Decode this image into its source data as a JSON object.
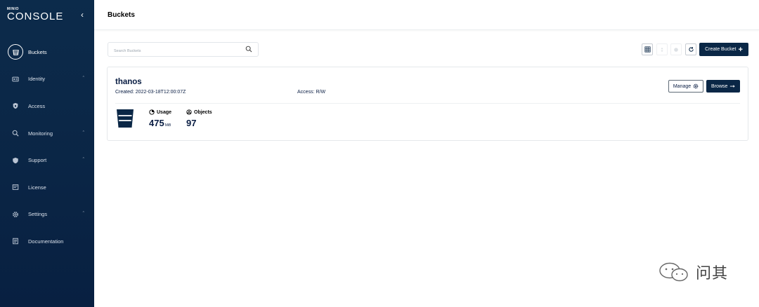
{
  "sidebar": {
    "logo_small": "MINIO",
    "logo_big": "CONSOLE",
    "items": [
      {
        "label": "Buckets",
        "icon": "bucket-icon",
        "active": true
      },
      {
        "label": "Identity",
        "icon": "identity-icon",
        "expandable": true
      },
      {
        "label": "Access",
        "icon": "lock-icon"
      },
      {
        "label": "Monitoring",
        "icon": "search-chart-icon",
        "expandable": true
      },
      {
        "label": "Support",
        "icon": "shield-icon",
        "expandable": true
      },
      {
        "label": "License",
        "icon": "license-icon"
      },
      {
        "label": "Settings",
        "icon": "gear-icon",
        "expandable": true
      },
      {
        "label": "Documentation",
        "icon": "document-icon"
      }
    ]
  },
  "header": {
    "title": "Buckets"
  },
  "search": {
    "placeholder": "Search Buckets"
  },
  "toolbar": {
    "create_label": "Create Bucket"
  },
  "bucket": {
    "name": "thanos",
    "created": "Created: 2022-03-18T12:00:07Z",
    "access": "Access: R/W",
    "manage_label": "Manage",
    "browse_label": "Browse",
    "usage_label": "Usage",
    "usage_value": "475",
    "usage_unit": "MiB",
    "objects_label": "Objects",
    "objects_value": "97"
  },
  "watermark": {
    "text": "问其"
  },
  "colors": {
    "sidebar": "#0b2747",
    "primary": "#0a2746",
    "text": "#081c42"
  }
}
